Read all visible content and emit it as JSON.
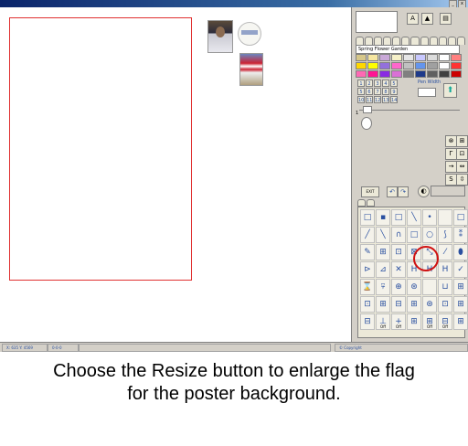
{
  "window": {
    "min_label": "_",
    "close_label": "x"
  },
  "palette": {
    "name": "Spring Flower Garden",
    "colors": [
      "#d6c78a",
      "#f5e6a0",
      "#c9a8d8",
      "#f5f0c8",
      "#e6e6e6",
      "#c8c8ff",
      "#dcdcdc",
      "#ffffff",
      "#ff8080",
      "#ffd700",
      "#ffff00",
      "#9370db",
      "#ff66cc",
      "#c0c0c0",
      "#6495ed",
      "#a0a0a0",
      "#ffffff",
      "#ff3333",
      "#ff69b4",
      "#ff1493",
      "#8a2be2",
      "#da70d6",
      "#808080",
      "#1e3a8a",
      "#606060",
      "#404040",
      "#cc0000"
    ]
  },
  "pen": {
    "label": "Pen Width",
    "numbers": [
      "1",
      "2",
      "3",
      "4",
      "5",
      "5",
      "6",
      "7",
      "8",
      "9",
      "10",
      "11",
      "12",
      "13",
      "14"
    ]
  },
  "slider": {
    "value": "1"
  },
  "exit_label": "EXIT",
  "status": {
    "coords": "X: 635 Y: 4569",
    "field2": "0-0-0",
    "copyright": "© Copyright"
  },
  "caption": {
    "line1": "Choose the Resize button to enlarge the flag",
    "line2": "for the poster background."
  },
  "tools": [
    "□",
    "▪",
    "□",
    "╲",
    "•",
    "",
    "□",
    "╱",
    "╲",
    "∩",
    "□",
    "○",
    "⟆",
    "⁑",
    "✎",
    "⊞",
    "⊡",
    "⊠",
    "⤡",
    "⁄",
    "⬮",
    "⊳",
    "⊿",
    "✕",
    "H",
    "H",
    "H",
    "✓",
    "⌛",
    "⍫",
    "⊕",
    "⊛",
    "",
    "⊔",
    "⊞",
    "⊡",
    "⊞",
    "⊟",
    "⊞",
    "⊛",
    "⊡",
    "⊞",
    "⊟",
    "⊥",
    "+",
    "⊞",
    "⊞",
    "⊟",
    "⊞"
  ],
  "off_label": "Off"
}
